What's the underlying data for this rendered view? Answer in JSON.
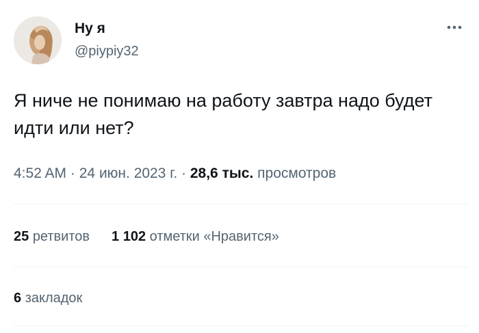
{
  "author": {
    "display_name": "Ну я",
    "handle": "@piypiy32"
  },
  "tweet": {
    "text": "Я ниче не понимаю на работу завтра надо будет идти или нет?",
    "time": "4:52 AM",
    "date": "24 июн. 2023 г.",
    "separator": "·",
    "views_count": "28,6 тыс.",
    "views_label": "просмотров"
  },
  "stats": {
    "retweets_count": "25",
    "retweets_label": "ретвитов",
    "likes_count": "1 102",
    "likes_label": "отметки «Нравится»",
    "bookmarks_count": "6",
    "bookmarks_label": "закладок"
  },
  "icons": {
    "more": "more-horizontal-icon"
  },
  "colors": {
    "text_primary": "#0f1419",
    "text_secondary": "#536471",
    "divider": "#eff3f4"
  }
}
